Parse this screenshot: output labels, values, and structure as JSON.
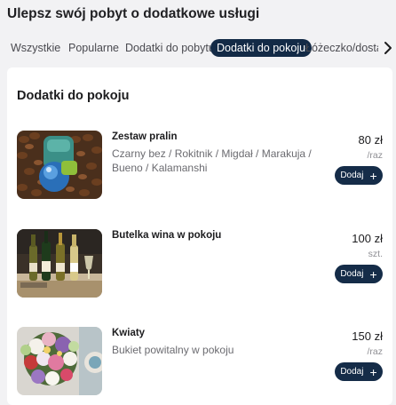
{
  "header": {
    "title": "Ulepsz swój pobyt o dodatkowe usługi"
  },
  "tabs": [
    {
      "label": "Wszystkie",
      "active": false
    },
    {
      "label": "Popularne",
      "active": false
    },
    {
      "label": "Dodatki do pobytu",
      "active": false
    },
    {
      "label": "Dodatki do pokoju",
      "active": true
    },
    {
      "label": "Łóżeczko/dostawka",
      "active": false
    }
  ],
  "tabs_scroll_icon": "chevron-right-icon",
  "section": {
    "title": "Dodatki do pokoju"
  },
  "items": [
    {
      "name": "Zestaw pralin",
      "description": "Czarny bez / Rokitnik / Migdał / Marakuja / Bueno / Kalamanshi",
      "price": "80 zł",
      "unit": "/raz",
      "button_label": "Dodaj",
      "button_icon": "plus-icon",
      "image": "pralines-photo"
    },
    {
      "name": "Butelka wina w pokoju",
      "description": "",
      "price": "100 zł",
      "unit": "szt.",
      "button_label": "Dodaj",
      "button_icon": "plus-icon",
      "image": "wine-bottles-photo"
    },
    {
      "name": "Kwiaty",
      "description": "Bukiet powitalny w pokoju",
      "price": "150 zł",
      "unit": "/raz",
      "button_label": "Dodaj",
      "button_icon": "plus-icon",
      "image": "flowers-photo"
    }
  ],
  "colors": {
    "accent": "#132a46",
    "page_background": "#f2f2f4",
    "card_background": "#ffffff",
    "secondary_text": "#6b6b70"
  }
}
